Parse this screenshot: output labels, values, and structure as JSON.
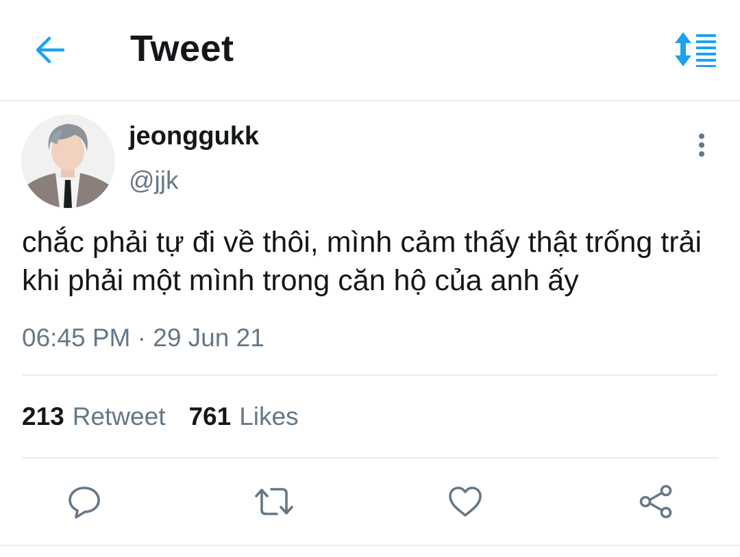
{
  "header": {
    "title": "Tweet",
    "back_icon": "arrow-left-icon",
    "sort_icon": "sort-arrows-icon"
  },
  "tweet": {
    "display_name": "jeonggukk",
    "handle": "@jjk",
    "text": "chắc phải tự đi về thôi, mình cảm thấy thật trống trải khi phải một mình trong căn hộ của anh ấy",
    "timestamp": "06:45 PM · 29 Jun 21",
    "more_icon": "more-vertical-icon"
  },
  "stats": {
    "retweet_count": "213",
    "retweet_label": "Retweet",
    "likes_count": "761",
    "likes_label": "Likes"
  },
  "actions": {
    "reply_icon": "reply-bubble-icon",
    "retweet_icon": "retweet-icon",
    "like_icon": "heart-icon",
    "share_icon": "share-icon"
  },
  "colors": {
    "accent": "#1da1f2",
    "text_primary": "#14171a",
    "text_secondary": "#657786",
    "divider": "#e6ecf0"
  }
}
